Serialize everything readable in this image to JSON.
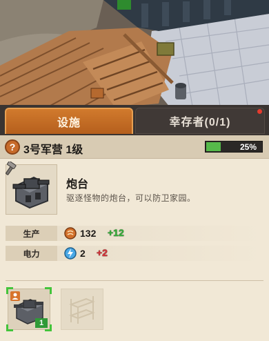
{
  "tabs": [
    {
      "label": "设施",
      "active": true
    },
    {
      "label": "幸存者(0/1)",
      "active": false
    }
  ],
  "building": {
    "title": "3号军营 1级",
    "progress_percent": 25,
    "progress_label": "25%"
  },
  "item": {
    "name": "炮台",
    "description": "驱逐怪物的炮台，可以防卫家园。"
  },
  "stats": {
    "production": {
      "label": "生产",
      "icon": "coin-icon",
      "value": "132",
      "delta": "+12"
    },
    "power": {
      "label": "电力",
      "icon": "lightning-icon",
      "value": "2",
      "delta": "+2"
    }
  },
  "slots": [
    {
      "icon": "cannon-turret-icon",
      "count": "1",
      "selected": true
    },
    {
      "icon": "bunk-bed-icon",
      "selected": false
    }
  ],
  "colors": {
    "tab_active": "#c96e25",
    "progress_fill": "#56b94a",
    "positive_delta": "#35b33a",
    "negative_delta": "#d8343a",
    "selection": "#43c43b"
  }
}
